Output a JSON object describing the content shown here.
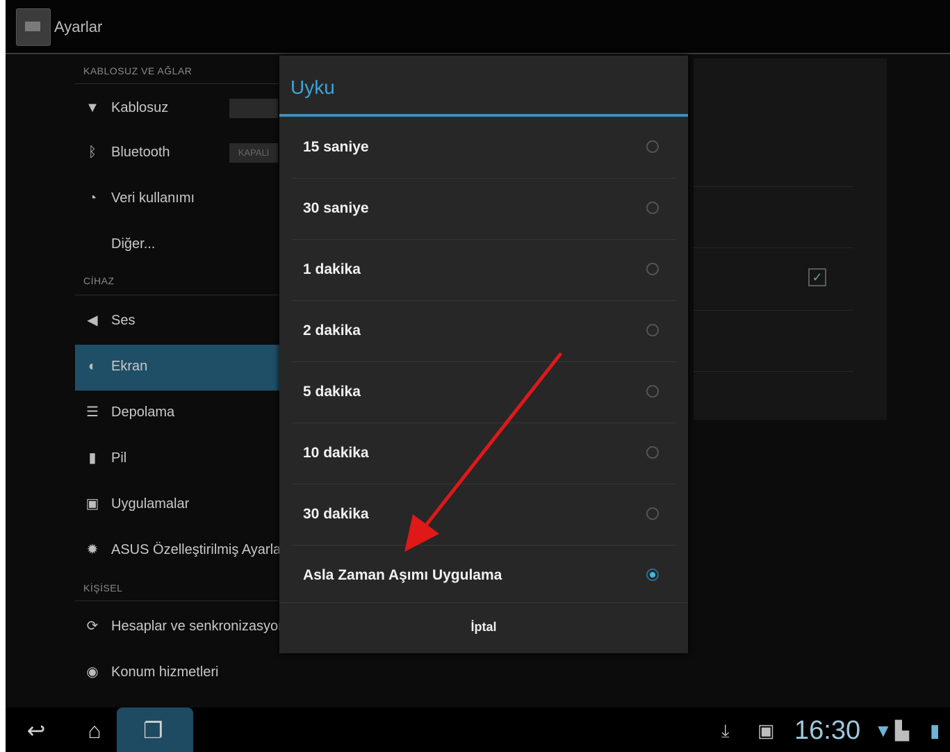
{
  "app": {
    "title": "Ayarlar"
  },
  "sidebar": {
    "section_wireless": "KABLOSUZ VE AĞLAR",
    "section_device": "CİHAZ",
    "section_personal": "KİŞİSEL",
    "items": [
      {
        "label": "Kablosuz",
        "icon": "wifi-icon"
      },
      {
        "label": "Bluetooth",
        "icon": "bluetooth-icon",
        "toggle": "KAPALI"
      },
      {
        "label": "Veri kullanımı",
        "icon": "data-usage-icon"
      },
      {
        "label": "Diğer..."
      },
      {
        "label": "Ses",
        "icon": "sound-icon"
      },
      {
        "label": "Ekran",
        "icon": "display-icon",
        "selected": true
      },
      {
        "label": "Depolama",
        "icon": "storage-icon"
      },
      {
        "label": "Pil",
        "icon": "battery-icon"
      },
      {
        "label": "Uygulamalar",
        "icon": "apps-icon"
      },
      {
        "label": "ASUS Özelleştirilmiş Ayarlar",
        "icon": "gear-icon"
      },
      {
        "label": "Hesaplar ve senkronizasyon",
        "icon": "sync-icon"
      },
      {
        "label": "Konum hizmetleri",
        "icon": "location-icon"
      }
    ]
  },
  "dialog": {
    "title": "Uyku",
    "options": [
      {
        "label": "15 saniye",
        "selected": false
      },
      {
        "label": "30 saniye",
        "selected": false
      },
      {
        "label": "1 dakika",
        "selected": false
      },
      {
        "label": "2 dakika",
        "selected": false
      },
      {
        "label": "5 dakika",
        "selected": false
      },
      {
        "label": "10 dakika",
        "selected": false
      },
      {
        "label": "30 dakika",
        "selected": false
      },
      {
        "label": "Asla Zaman Aşımı Uygulama",
        "selected": true
      }
    ],
    "cancel_label": "İptal"
  },
  "navbar": {
    "clock": "16:30"
  },
  "colors": {
    "accent": "#39a5d8",
    "selected_bg": "#1f4f66",
    "arrow": "#e01818"
  }
}
